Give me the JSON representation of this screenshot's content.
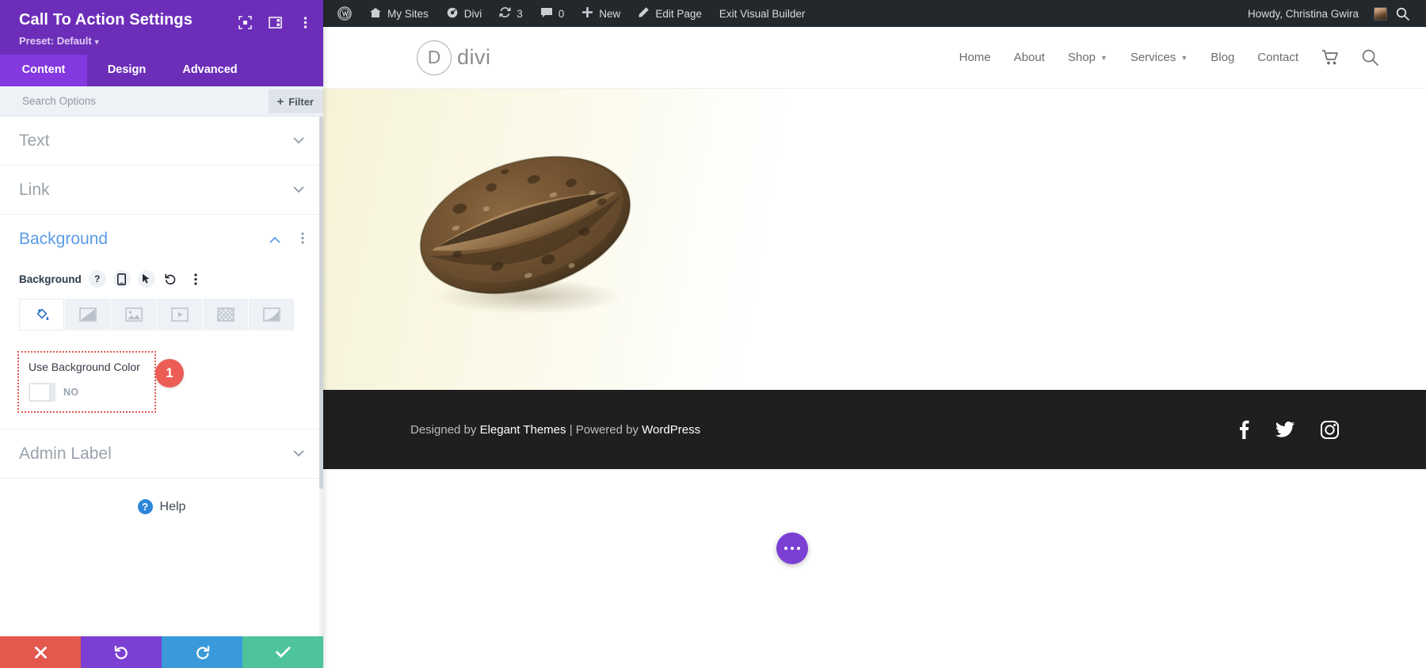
{
  "panel": {
    "title": "Call To Action Settings",
    "preset_label": "Preset: Default",
    "header_icons": [
      {
        "name": "focus-icon"
      },
      {
        "name": "layout-columns-icon"
      },
      {
        "name": "vertical-dots-icon"
      }
    ],
    "tabs": [
      {
        "id": "content",
        "label": "Content",
        "active": true
      },
      {
        "id": "design",
        "label": "Design",
        "active": false
      },
      {
        "id": "advanced",
        "label": "Advanced",
        "active": false
      }
    ],
    "search": {
      "placeholder": "Search Options",
      "value": ""
    },
    "filter_button": {
      "label": "Filter",
      "plus": "+"
    },
    "sections": [
      {
        "id": "text",
        "label": "Text",
        "open": false,
        "chevron": "⌄"
      },
      {
        "id": "link",
        "label": "Link",
        "open": false,
        "chevron": "⌄"
      },
      {
        "id": "background",
        "label": "Background",
        "open": true,
        "chevron": "⌃"
      },
      {
        "id": "admin_label",
        "label": "Admin Label",
        "open": false,
        "chevron": "⌄"
      }
    ],
    "background": {
      "control_label": "Background",
      "control_icons": [
        {
          "name": "help-icon",
          "glyph": "?"
        },
        {
          "name": "responsive-phone-icon",
          "glyph": ""
        },
        {
          "name": "hover-cursor-icon",
          "glyph": ""
        },
        {
          "name": "reset-undo-icon",
          "glyph": "↺"
        },
        {
          "name": "more-options-dots-icon",
          "glyph": "⋮"
        }
      ],
      "types": [
        {
          "id": "color",
          "name": "background-color-tab",
          "active": true
        },
        {
          "id": "gradient",
          "name": "background-gradient-tab",
          "active": false
        },
        {
          "id": "image",
          "name": "background-image-tab",
          "active": false
        },
        {
          "id": "video",
          "name": "background-video-tab",
          "active": false
        },
        {
          "id": "pattern",
          "name": "background-pattern-tab",
          "active": false
        },
        {
          "id": "mask",
          "name": "background-mask-tab",
          "active": false
        }
      ],
      "toggle": {
        "label": "Use Background Color",
        "state": "NO",
        "enabled": false,
        "annotation_badge": "1",
        "annotation_color": "#eb5d55"
      }
    },
    "help": {
      "label": "Help",
      "glyph": "?"
    },
    "actions": [
      {
        "id": "cancel",
        "name": "cancel-button",
        "color": "#e4584e",
        "glyph": "✖"
      },
      {
        "id": "undo",
        "name": "undo-button",
        "color": "#7b3fd4",
        "glyph": "↺"
      },
      {
        "id": "redo",
        "name": "redo-button",
        "color": "#3a9ad9",
        "glyph": "↻"
      },
      {
        "id": "save",
        "name": "save-button",
        "color": "#4ec49a",
        "glyph": "✔"
      }
    ]
  },
  "admin_bar": {
    "items": [
      {
        "id": "wp-logo",
        "label": "",
        "icon": "wordpress-logo-icon"
      },
      {
        "id": "my-sites",
        "label": "My Sites",
        "icon": "sites-icon"
      },
      {
        "id": "divi",
        "label": "Divi",
        "icon": "divi-dashboard-icon"
      },
      {
        "id": "updates",
        "label": "3",
        "icon": "updates-refresh-icon"
      },
      {
        "id": "comments",
        "label": "0",
        "icon": "comment-bubble-icon"
      },
      {
        "id": "new",
        "label": "New",
        "icon": "plus-icon"
      },
      {
        "id": "edit-page",
        "label": "Edit Page",
        "icon": "pencil-icon"
      },
      {
        "id": "exit-vb",
        "label": "Exit Visual Builder",
        "icon": ""
      }
    ],
    "greeting": "Howdy, Christina Gwira",
    "search_icon": "search-icon"
  },
  "site": {
    "logo": {
      "mark": "D",
      "word": "divi"
    },
    "nav": [
      {
        "label": "Home",
        "has_dropdown": false
      },
      {
        "label": "About",
        "has_dropdown": false
      },
      {
        "label": "Shop",
        "has_dropdown": true
      },
      {
        "label": "Services",
        "has_dropdown": true
      },
      {
        "label": "Blog",
        "has_dropdown": false
      },
      {
        "label": "Contact",
        "has_dropdown": false
      }
    ],
    "nav_icons": [
      {
        "name": "cart-icon"
      },
      {
        "name": "search-icon"
      }
    ],
    "hero": {
      "image_alt": "artisan bread loaf"
    },
    "footer": {
      "text_before": "Designed by ",
      "link1": "Elegant Themes",
      "separator": " | ",
      "text_middle": "Powered by ",
      "link2": "WordPress",
      "socials": [
        {
          "name": "facebook-icon",
          "glyph": "f"
        },
        {
          "name": "twitter-icon",
          "glyph": "t"
        },
        {
          "name": "instagram-icon",
          "glyph": "i"
        }
      ]
    },
    "fab": {
      "name": "divi-menu-fab",
      "glyph": "•••"
    }
  }
}
